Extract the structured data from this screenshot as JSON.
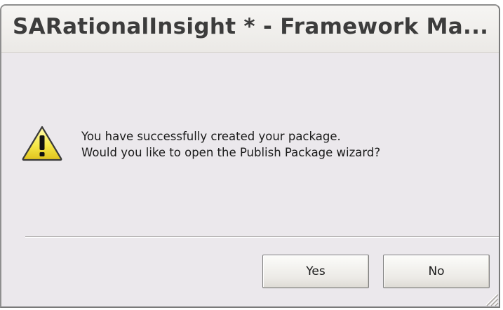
{
  "window": {
    "title": "SARationalInsight * - Framework Ma..."
  },
  "dialog": {
    "icon": "warning-icon",
    "message_line1": "You have successfully created your package.",
    "message_line2": "Would you like to open the Publish Package wizard?"
  },
  "buttons": {
    "yes_label": "Yes",
    "no_label": "No"
  },
  "colors": {
    "dialog_background": "#ebe8ec",
    "warning_fill": "#f7e94a",
    "warning_outline": "#3a3a3a"
  }
}
